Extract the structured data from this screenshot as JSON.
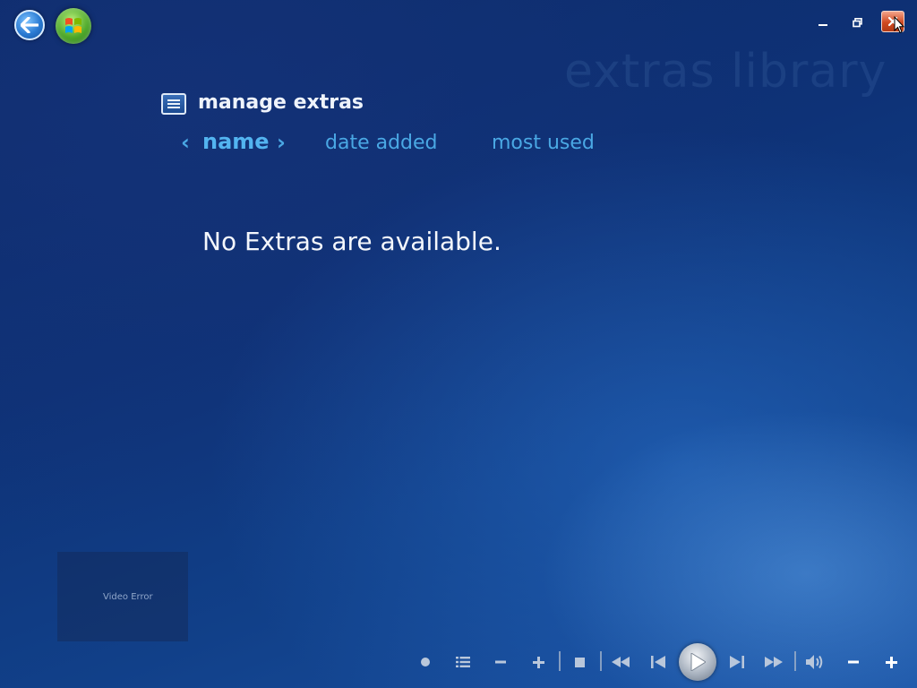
{
  "header": {
    "watermark_title": "extras library",
    "page_title": "manage extras"
  },
  "sort_tabs": [
    {
      "label": "name",
      "active": true
    },
    {
      "label": "date added",
      "active": false
    },
    {
      "label": "most used",
      "active": false
    }
  ],
  "main": {
    "empty_message": "No Extras are available."
  },
  "video_preview": {
    "status_text": "Video Error"
  },
  "icons": {
    "back": "back-arrow-icon",
    "start": "windows-start-icon",
    "minimize": "minimize-icon",
    "restore": "restore-icon",
    "close": "close-icon",
    "list": "list-icon",
    "record": "record-icon",
    "channel_list": "list-icon",
    "channel_down": "minus-icon",
    "channel_up": "plus-icon",
    "stop": "stop-icon",
    "rewind": "rewind-icon",
    "previous": "skip-previous-icon",
    "play": "play-icon",
    "next": "skip-next-icon",
    "fast_forward": "fast-forward-icon",
    "mute": "speaker-icon",
    "volume_down": "minus-icon",
    "volume_up": "plus-icon"
  },
  "colors": {
    "background": "#0e3277",
    "accent": "#4aa8e4",
    "text": "#f4f7fc",
    "close_button": "#d04a22"
  }
}
